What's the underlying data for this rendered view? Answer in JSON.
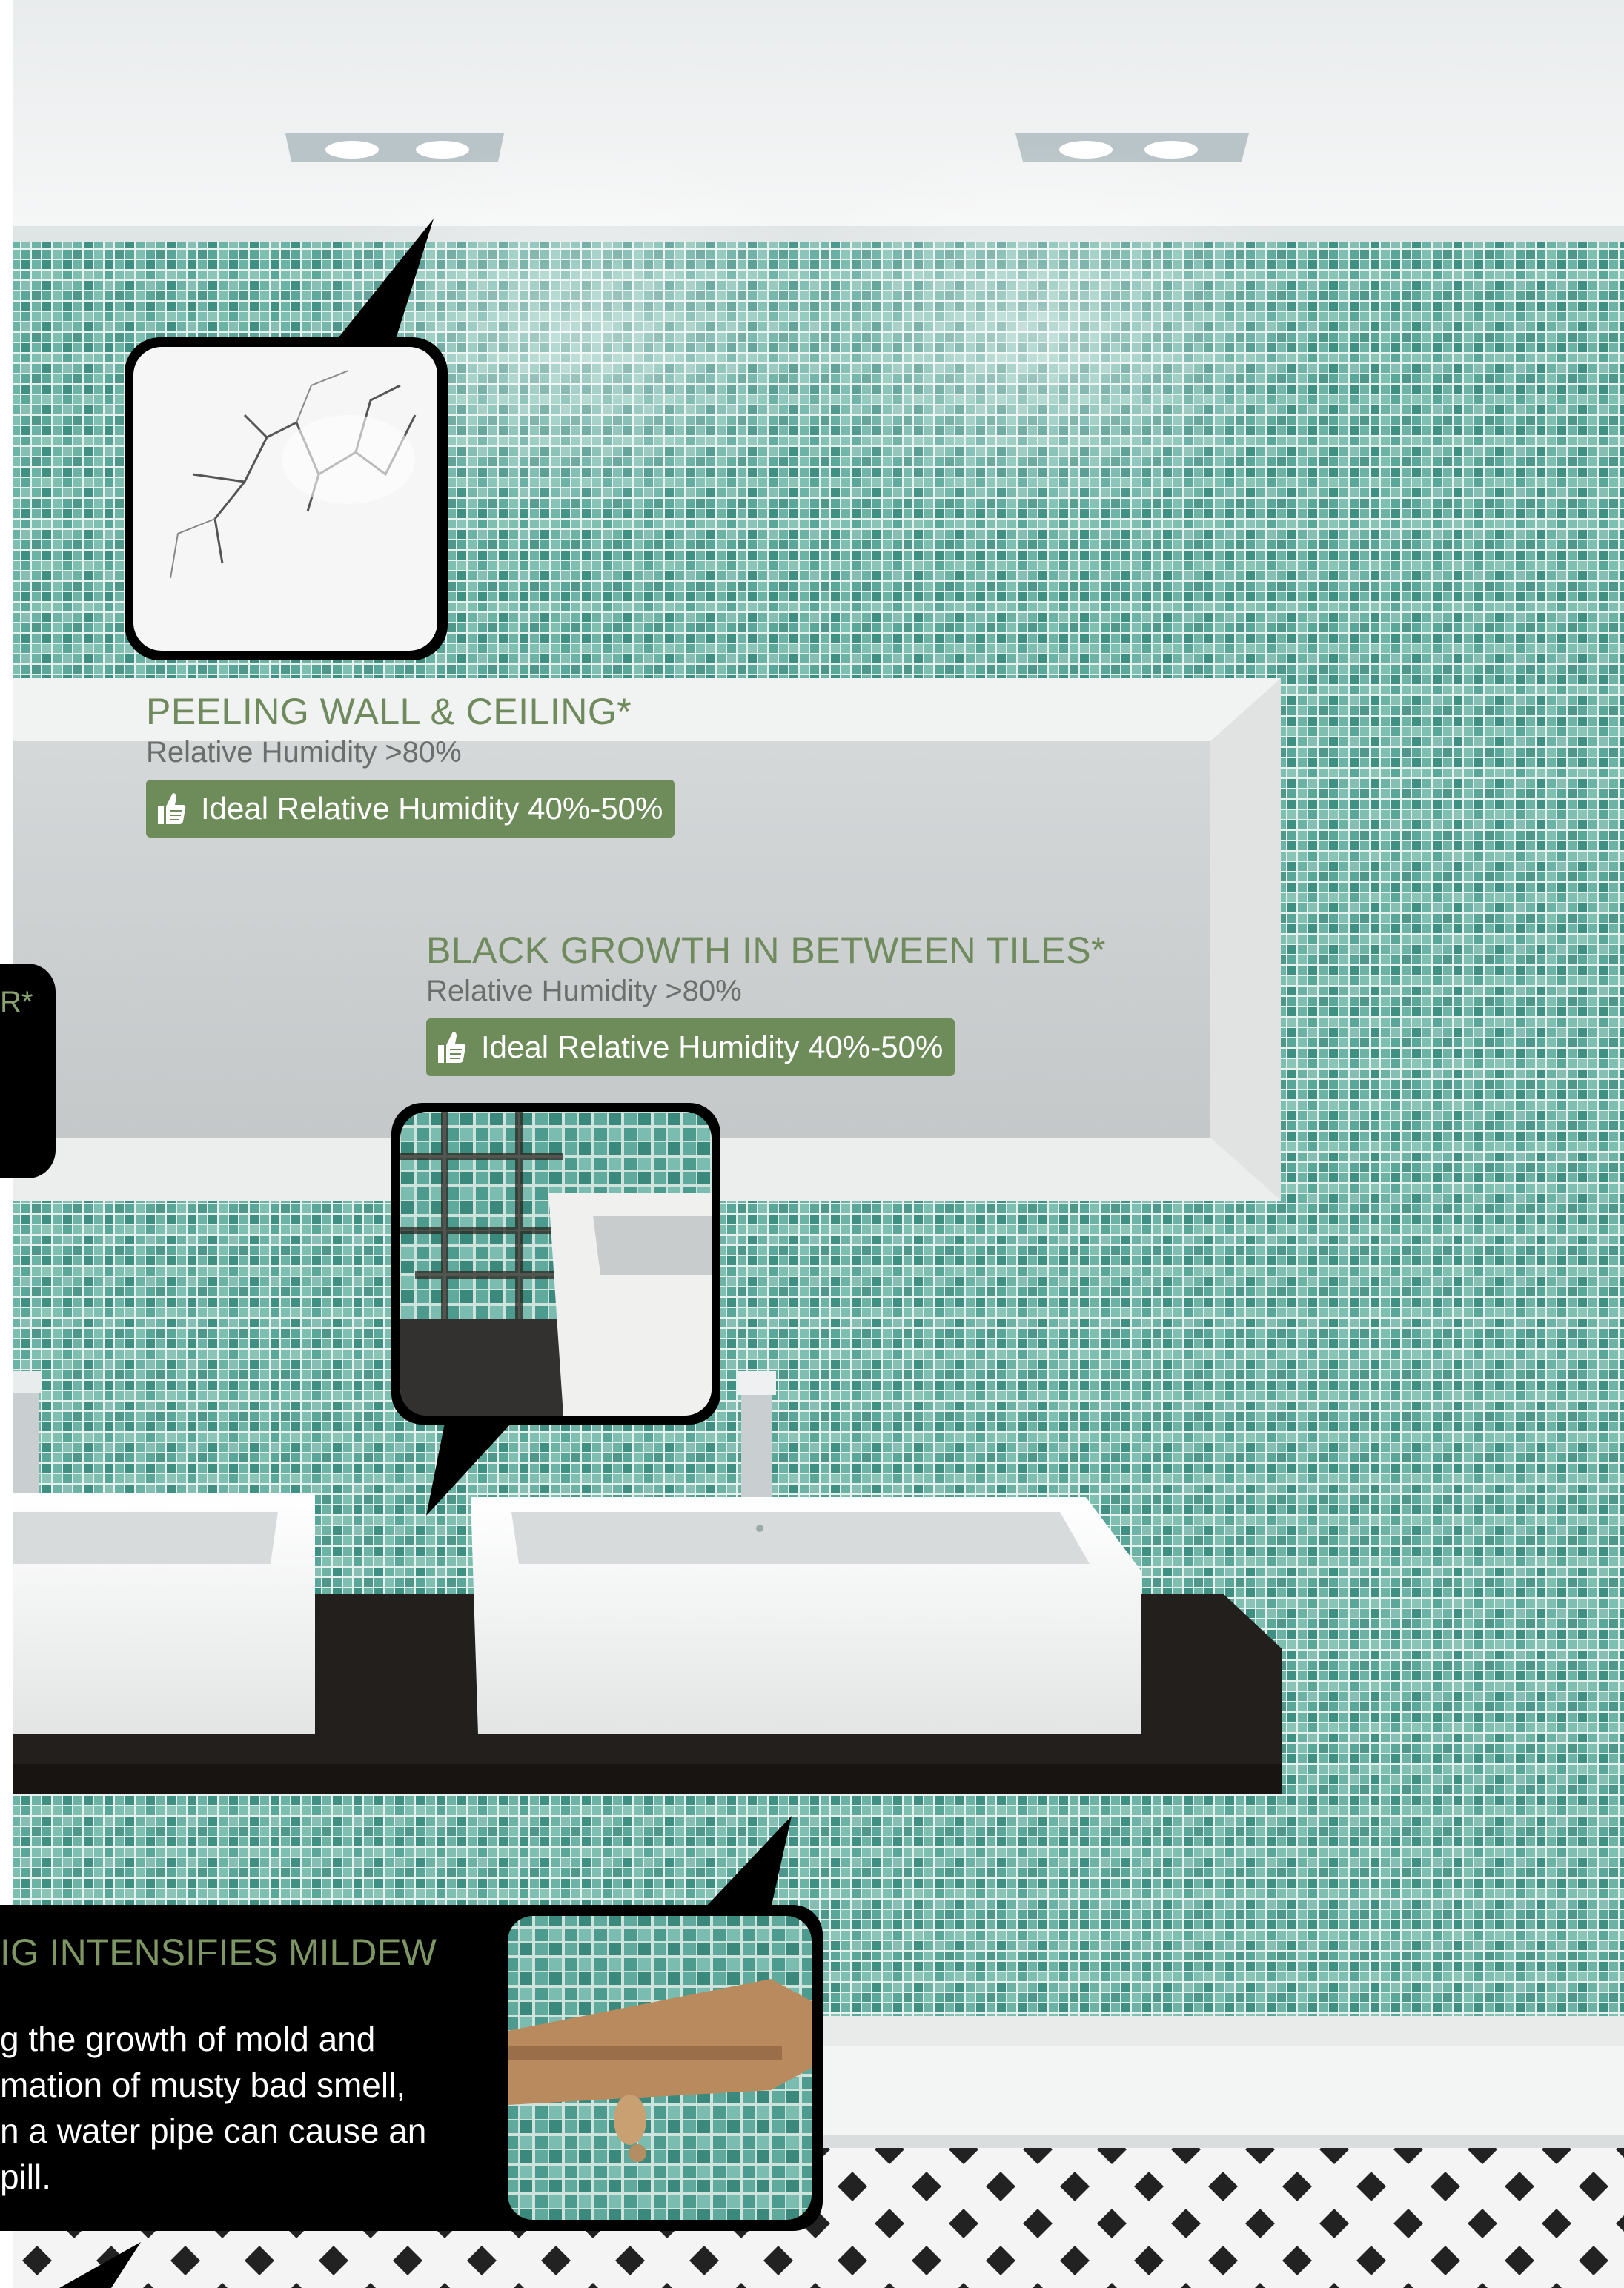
{
  "callouts": [
    {
      "title": "PEELING WALL & CEILING*",
      "subtitle": "Relative Humidity >80%",
      "badge": "Ideal Relative Humidity 40%-50%"
    },
    {
      "title": "BLACK GROWTH IN BETWEEN TILES*",
      "subtitle": "Relative Humidity >80%",
      "badge": "Ideal Relative Humidity 40%-50%"
    }
  ],
  "side_label": "R*",
  "mildew": {
    "title": "IG INTENSIFIES MILDEW",
    "lines": [
      "g the growth of mold and",
      "mation of musty bad smell,",
      "n a water pipe can cause an",
      "pill."
    ]
  },
  "icons": [
    "thumbs-up-icon"
  ],
  "colors": {
    "accent_green": "#6e8c5a",
    "tile": "#5aa79a",
    "counter": "#231f1d"
  }
}
